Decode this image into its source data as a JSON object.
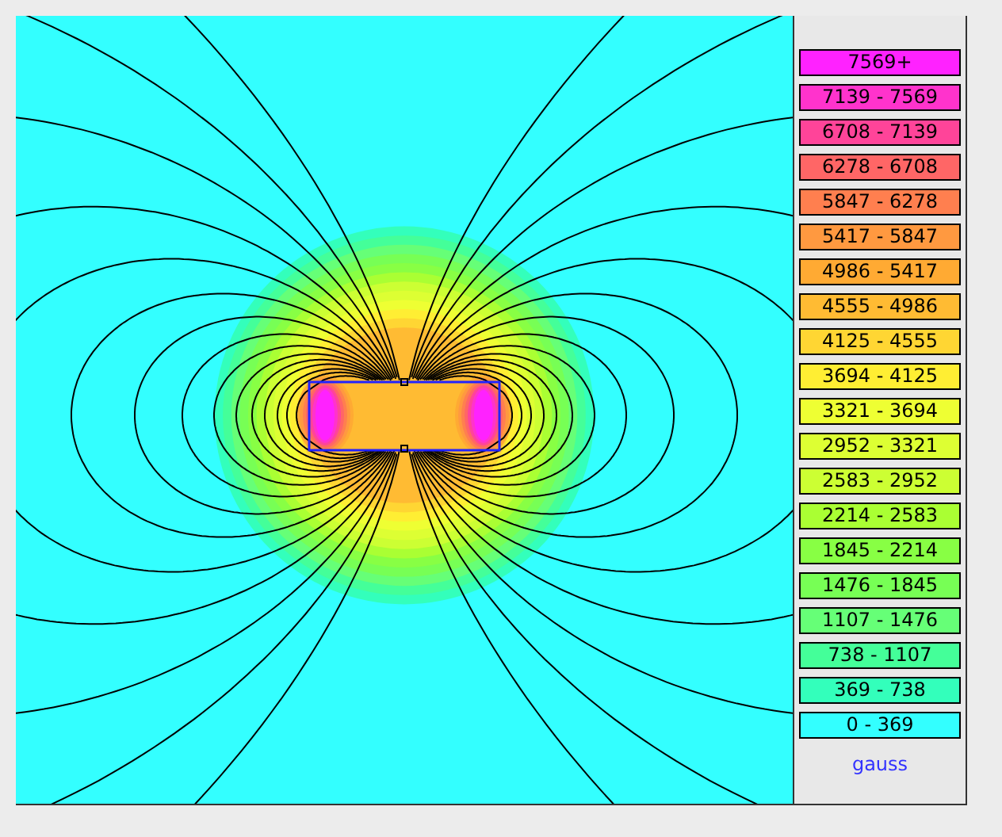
{
  "legend": {
    "unit": "gauss",
    "items": [
      {
        "label": "7569+",
        "color": "#ff22ff"
      },
      {
        "label": "7139 - 7569",
        "color": "#ff33cc"
      },
      {
        "label": "6708 - 7139",
        "color": "#ff4499"
      },
      {
        "label": "6278 - 6708",
        "color": "#ff6666"
      },
      {
        "label": "5847 - 6278",
        "color": "#ff7f4f"
      },
      {
        "label": "5417 - 5847",
        "color": "#ff9940"
      },
      {
        "label": "4986 - 5417",
        "color": "#ffaa33"
      },
      {
        "label": "4555 - 4986",
        "color": "#ffbb33"
      },
      {
        "label": "4125 - 4555",
        "color": "#ffd633"
      },
      {
        "label": "3694 - 4125",
        "color": "#ffee33"
      },
      {
        "label": "3321 - 3694",
        "color": "#eeff33"
      },
      {
        "label": "2952 - 3321",
        "color": "#ddff33"
      },
      {
        "label": "2583 - 2952",
        "color": "#ccff33"
      },
      {
        "label": "2214 - 2583",
        "color": "#aaff33"
      },
      {
        "label": "1845 - 2214",
        "color": "#88ff44"
      },
      {
        "label": "1476 - 1845",
        "color": "#77ff55"
      },
      {
        "label": "1107 - 1476",
        "color": "#66ff77"
      },
      {
        "label": "738 - 1107",
        "color": "#44ff99"
      },
      {
        "label": "369 - 738",
        "color": "#33ffbb"
      },
      {
        "label": "0 - 369",
        "color": "#33ffff"
      }
    ]
  }
}
